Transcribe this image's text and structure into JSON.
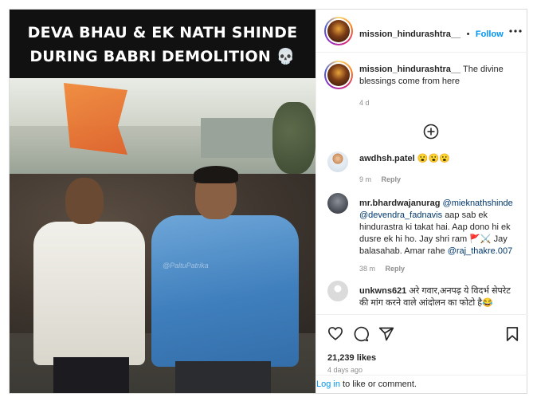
{
  "media": {
    "caption_line1": "DEVA BHAU & EK NATH SHINDE",
    "caption_line2": "DURING BABRI DEMOLITION 💀",
    "watermark": "@PaltuPatrika"
  },
  "header": {
    "username": "mission_hindurashtra__",
    "dot": "•",
    "follow_label": "Follow",
    "more_icon": "more-horizontal-icon"
  },
  "caption": {
    "username": "mission_hindurashtra__",
    "text": "The divine blessings come from here",
    "time": "4 d"
  },
  "load_more": {
    "icon": "plus-circle-icon"
  },
  "comments": [
    {
      "username": "awdhsh.patel",
      "text": "😮😮😮",
      "time": "9 m",
      "reply": "Reply"
    },
    {
      "username": "mr.bhardwajanurag",
      "mention1": "@mieknathshinde",
      "mention2": "@devendra_fadnavis",
      "text1": "aap sab ek hindurastra ki takat hai. Aap dono hi ek dusre ek hi ho. Jay shri ram 🚩⚔️ Jay balasahab. Amar rahe",
      "mention3": "@raj_thakre.007",
      "time": "38 m",
      "reply": "Reply"
    },
    {
      "username": "unkwns621",
      "text": "अरे गवार,अनपढ़ ये विदर्भ सेपरेट की मांग करने वाले आंदोलन का फोटो है😂"
    }
  ],
  "actions": {
    "like_icon": "heart-icon",
    "comment_icon": "comment-icon",
    "share_icon": "send-icon",
    "save_icon": "bookmark-icon",
    "likes": "21,239 likes",
    "date": "4 days ago"
  },
  "login": {
    "link": "Log in",
    "text": " to like or comment."
  },
  "colors": {
    "link_blue": "#0095f6",
    "mention": "#00376b",
    "meta_gray": "#8e8e8e"
  }
}
